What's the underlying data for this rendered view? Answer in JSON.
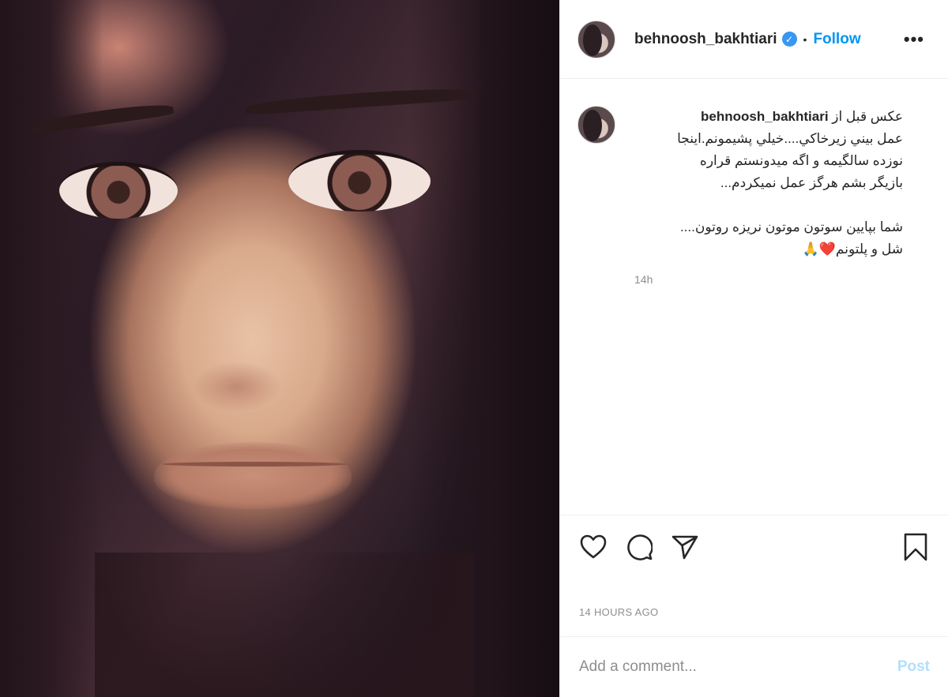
{
  "post": {
    "username": "behnoosh_bakhtiari",
    "follow_label": "Follow",
    "separator": "•",
    "more_label": "•••",
    "verified_mark": "✓",
    "caption_line1": "عکس قبل از",
    "caption_rest": "عمل بيني زيرخاكي....خيلي پشيمونم.اينجا\nنوزده سالگيمه و اگه ميدونستم قراره\nبازيگر بشم هرگز عمل نميكردم...\n\nشما بپايين سوتون موتون نريزه روتون....\nشل و پلتونم❤️🙏",
    "caption_time": "14h",
    "timestamp": "14 HOURS AGO"
  },
  "actions": {
    "like_icon": "heart-icon",
    "comment_icon": "comment-icon",
    "share_icon": "paper-plane-icon",
    "save_icon": "bookmark-icon"
  },
  "comment_box": {
    "placeholder": "Add a comment...",
    "post_label": "Post"
  },
  "colors": {
    "accent": "#0095f6",
    "verified": "#3897f0",
    "post_disabled": "#b2dffc",
    "muted": "#8e8e8e"
  }
}
